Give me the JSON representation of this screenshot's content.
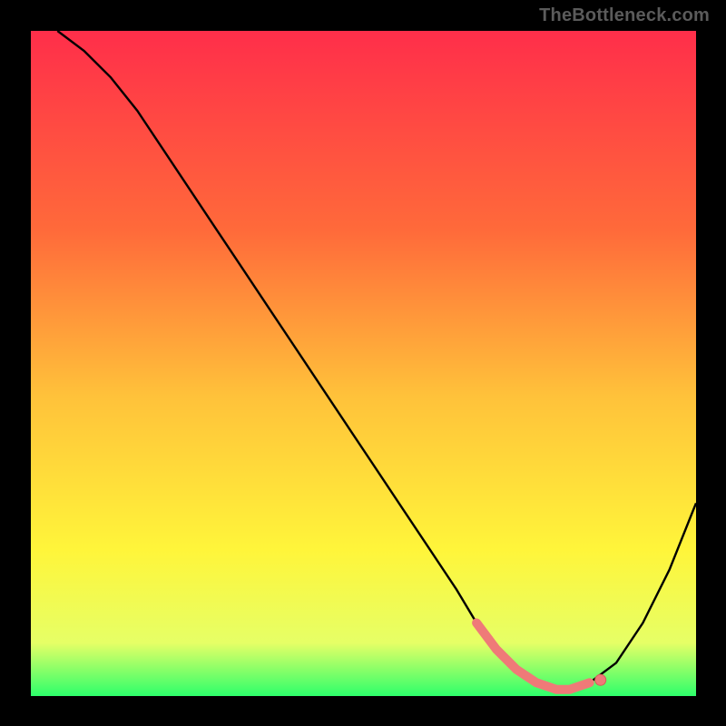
{
  "attribution": "TheBottleneck.com",
  "colors": {
    "top_gradient": "#ff2e4a",
    "mid1_gradient": "#ff6a3a",
    "mid2_gradient": "#ffc23a",
    "mid3_gradient": "#fff53a",
    "near_bottom_gradient": "#e6ff66",
    "bottom_gradient": "#2dff6b",
    "curve": "#000000",
    "marker_fill": "#ef7a78",
    "marker_stroke": "#d85a58",
    "frame_bg": "#000000"
  },
  "chart_data": {
    "type": "line",
    "title": "",
    "xlabel": "",
    "ylabel": "",
    "xlim": [
      0,
      100
    ],
    "ylim": [
      0,
      100
    ],
    "series": [
      {
        "name": "bottleneck-curve",
        "x": [
          4,
          8,
          12,
          16,
          20,
          24,
          28,
          32,
          36,
          40,
          44,
          48,
          52,
          56,
          60,
          64,
          67,
          70,
          73,
          76,
          79,
          81,
          84,
          88,
          92,
          96,
          100
        ],
        "values": [
          100,
          97,
          93,
          88,
          82,
          76,
          70,
          64,
          58,
          52,
          46,
          40,
          34,
          28,
          22,
          16,
          11,
          7,
          4,
          2,
          1,
          1,
          2,
          5,
          11,
          19,
          29
        ]
      }
    ],
    "markers": {
      "name": "highlighted-minimum",
      "x": [
        67,
        70,
        73,
        76,
        79,
        81,
        84
      ],
      "values": [
        11,
        7,
        4,
        2,
        1,
        1,
        2
      ]
    }
  }
}
